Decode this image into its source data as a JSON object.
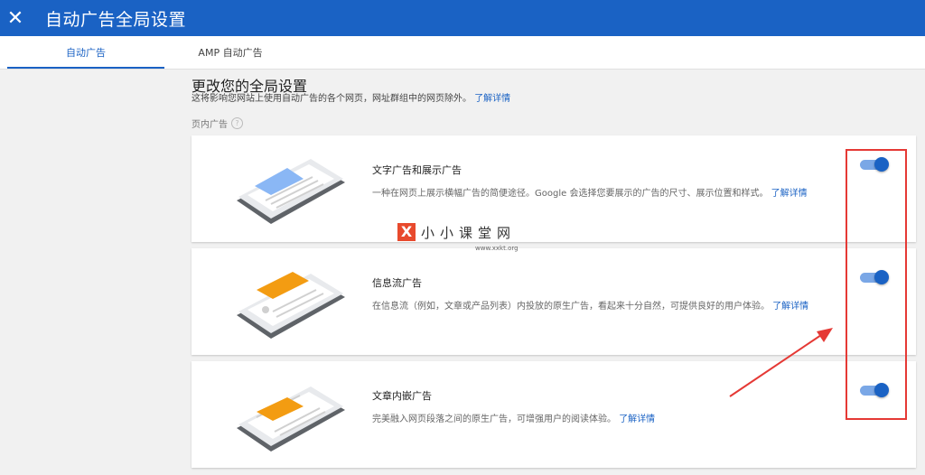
{
  "header": {
    "close_glyph": "✕",
    "title": "自动广告全局设置"
  },
  "tabs": [
    {
      "label": "自动广告",
      "active": true
    },
    {
      "label": "AMP 自动广告",
      "active": false
    }
  ],
  "main": {
    "heading": "更改您的全局设置",
    "subheading": "这将影响您网站上使用自动广告的各个网页，网址群组中的网页除外。",
    "learn_more": "了解详情",
    "section_label": "页内广告",
    "help_glyph": "?"
  },
  "cards": [
    {
      "title": "文字广告和展示广告",
      "description": "一种在网页上展示横幅广告的简便途径。Google 会选择您要展示的广告的尺寸、展示位置和样式。",
      "link": "了解详情",
      "enabled": true
    },
    {
      "title": "信息流广告",
      "description": "在信息流（例如，文章或产品列表）内投放的原生广告，看起来十分自然，可提供良好的用户体验。",
      "link": "了解详情",
      "enabled": true
    },
    {
      "title": "文章内嵌广告",
      "description": "完美融入网页段落之间的原生广告，可增强用户的阅读体验。",
      "link": "了解详情",
      "enabled": true
    }
  ],
  "watermark": {
    "logo": "X",
    "text": "小小课堂网",
    "url": "www.xxkt.org"
  },
  "colors": {
    "primary": "#1a62c4",
    "toggle_track": "#7aa7e6",
    "annotation": "#e53935",
    "illustration_blue": "#8ab7f5",
    "illustration_orange": "#f39c12"
  }
}
